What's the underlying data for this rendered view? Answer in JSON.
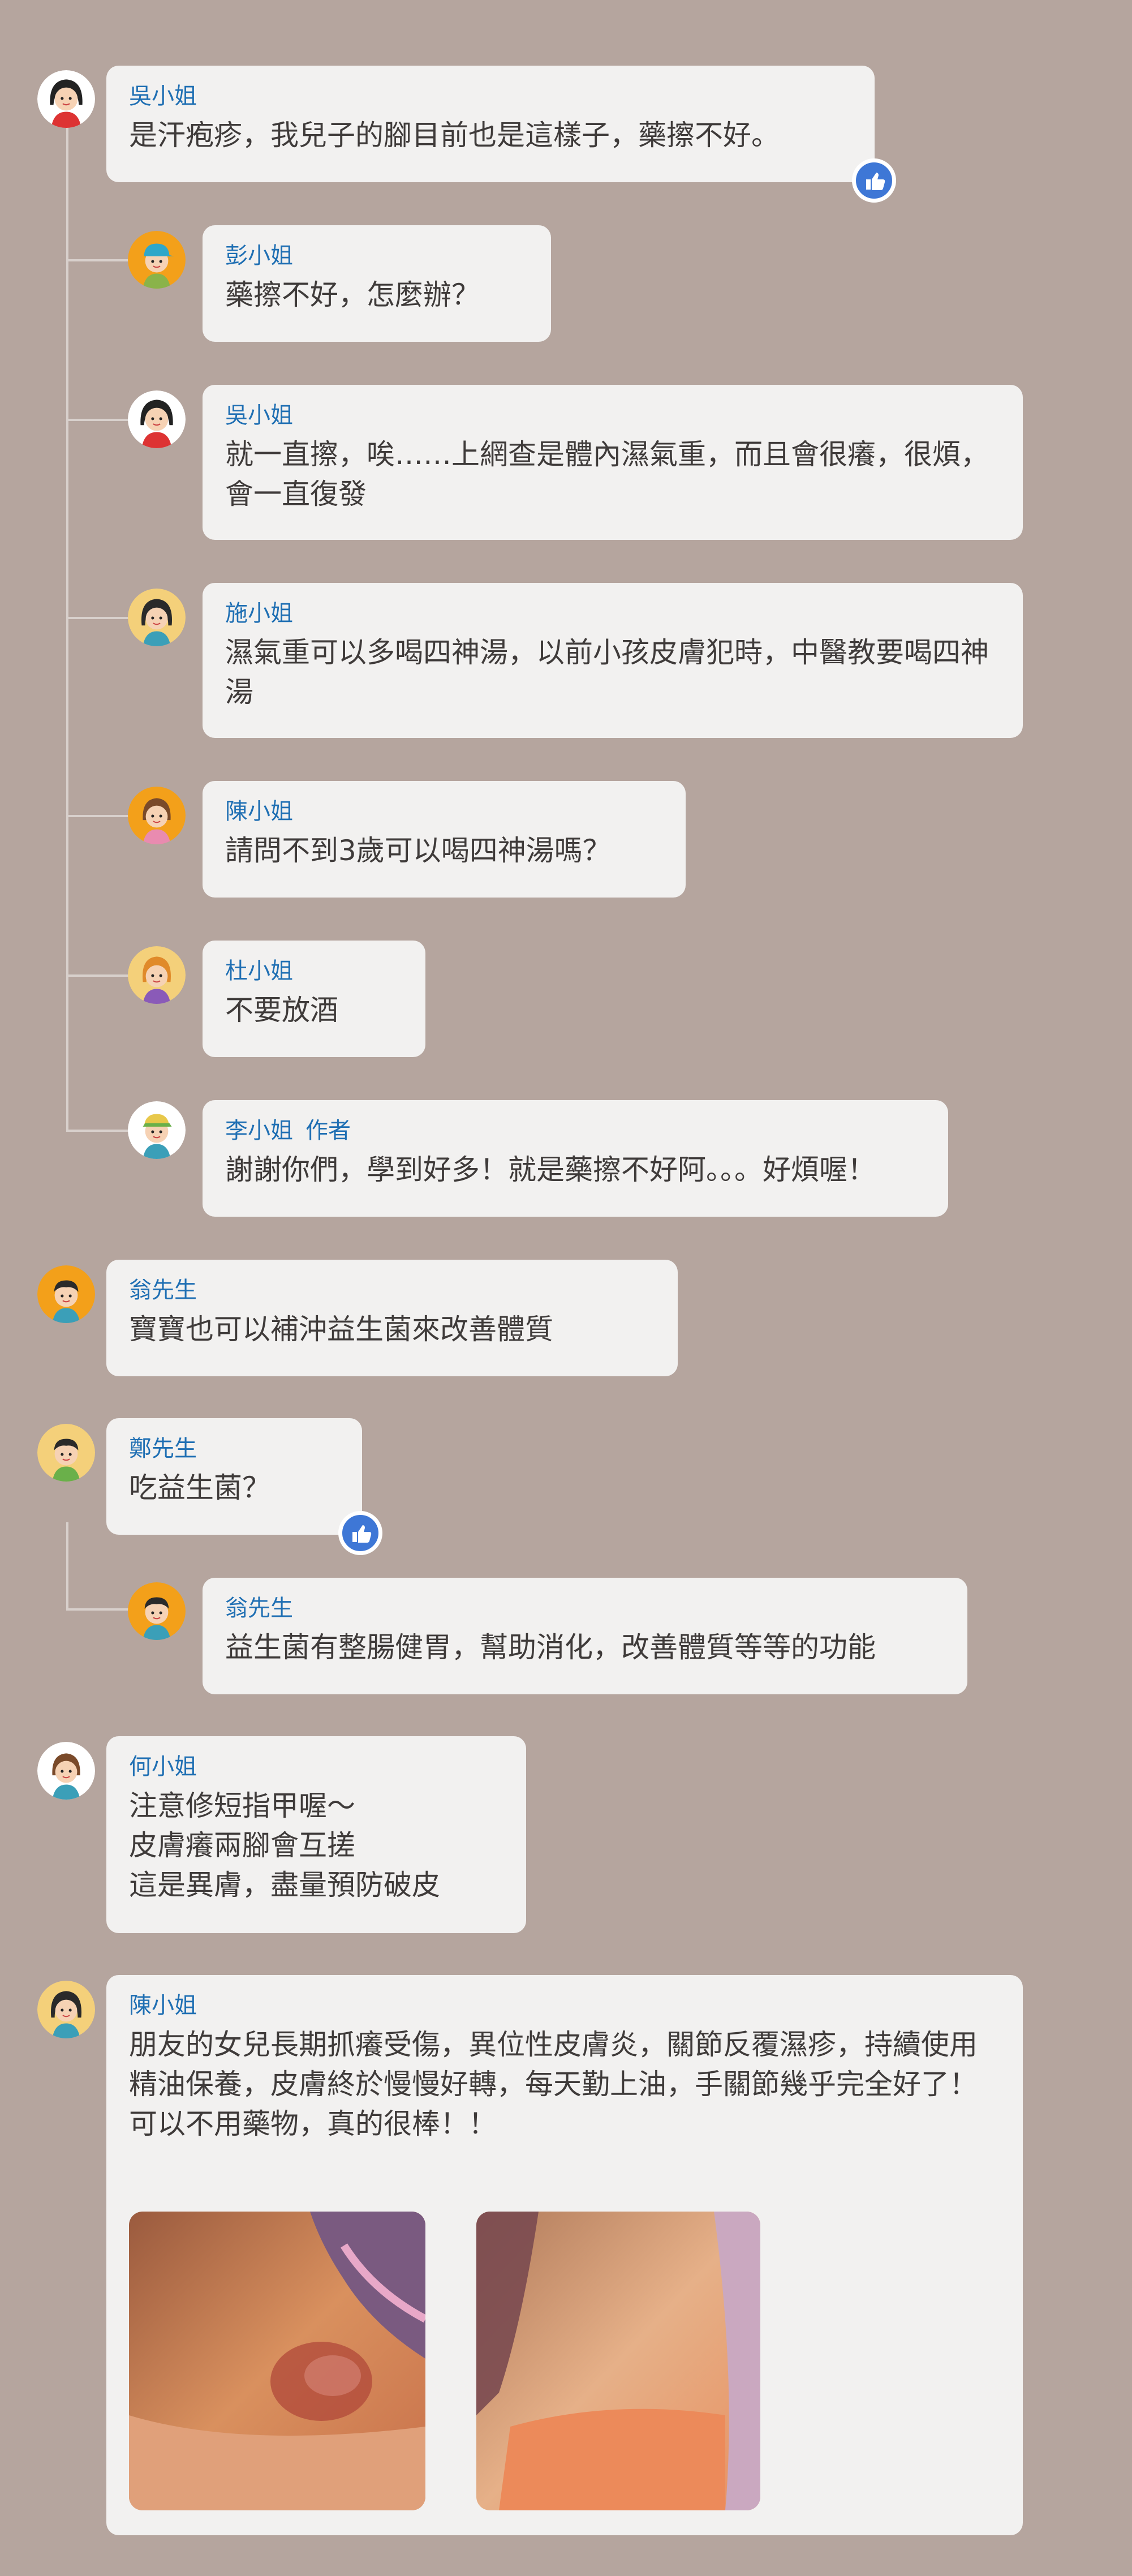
{
  "comments": [
    {
      "name": "吳小姐",
      "text": "是汗疱疹，我兒子的腳目前也是這樣子，藥擦不好。",
      "avatar": "woman-avatar-icon"
    },
    {
      "name": "彭小姐",
      "text": "藥擦不好，怎麼辦？",
      "avatar": "man-cap-avatar-icon"
    },
    {
      "name": "吳小姐",
      "text": "就一直擦，唉……上網查是體內濕氣重，而且會很癢，很煩，會一直復發",
      "avatar": "woman-avatar-icon"
    },
    {
      "name": "施小姐",
      "text": "濕氣重可以多喝四神湯，以前小孩皮膚犯時，中醫教要喝四神湯",
      "avatar": "woman-avatar-icon"
    },
    {
      "name": "陳小姐",
      "text": "請問不到3歲可以喝四神湯嗎？",
      "avatar": "woman-avatar-icon"
    },
    {
      "name": "杜小姐",
      "text": "不要放酒",
      "avatar": "woman-avatar-icon"
    },
    {
      "name": "李小姐",
      "role": "作者",
      "text": "謝謝你們，學到好多！就是藥擦不好阿。。。好煩喔！",
      "avatar": "woman-cap-avatar-icon"
    },
    {
      "name": "翁先生",
      "text": "寶寶也可以補沖益生菌來改善體質",
      "avatar": "man-avatar-icon"
    },
    {
      "name": "鄭先生",
      "text": "吃益生菌？",
      "avatar": "man-avatar-icon"
    },
    {
      "name": "翁先生",
      "text": "益生菌有整腸健胃，幫助消化，改善體質等等的功能",
      "avatar": "man-avatar-icon"
    },
    {
      "name": "何小姐",
      "text": "注意修短指甲喔～\n皮膚癢兩腳會互搓\n這是異膚，盡量預防破皮",
      "avatar": "woman-avatar-icon"
    },
    {
      "name": "陳小姐",
      "text": "朋友的女兒長期抓癢受傷，異位性皮膚炎，關節反覆濕疹，持續使用精油保養，皮膚終於慢慢好轉，每天勤上油，手關節幾乎完全好了！\n可以不用藥物，真的很棒！！",
      "avatar": "woman-avatar-icon"
    }
  ],
  "photos": [
    {
      "alt": "before-photo"
    },
    {
      "alt": "after-photo"
    }
  ],
  "colors": {
    "background": "#b5a59e",
    "bubble": "#f2f1f0",
    "name": "#1f6fb3",
    "like": "#3e77d6",
    "thread": "#d8d0cc"
  }
}
